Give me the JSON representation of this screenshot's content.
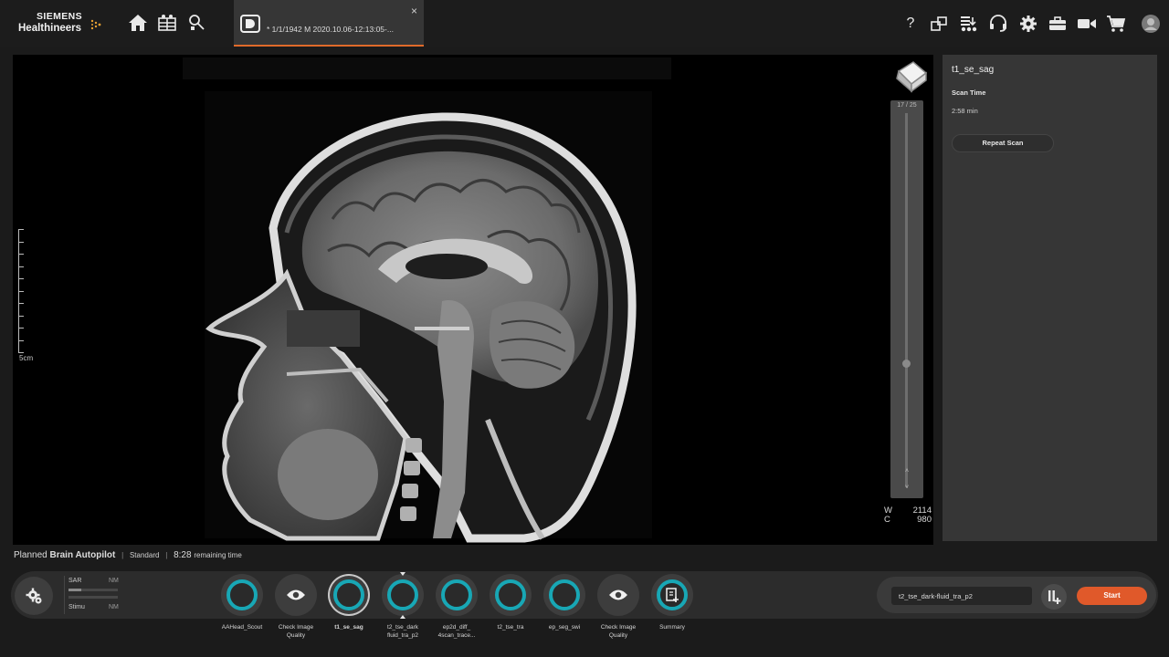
{
  "brand": {
    "line1": "SIEMENS",
    "line2": "Healthineers"
  },
  "nav": {
    "home_icon": "home-icon",
    "worklist_icon": "worklist-icon",
    "search_icon": "patient-search-icon"
  },
  "tab": {
    "label": "* 1/1/1942 M 2020.10.06-12:13:05-...",
    "close": "×",
    "icon": "patient-exam-icon"
  },
  "toolbar_right": [
    {
      "icon": "help-icon",
      "glyph": "?"
    },
    {
      "icon": "windows-icon"
    },
    {
      "icon": "queue-icon"
    },
    {
      "icon": "headset-icon"
    },
    {
      "icon": "settings-gear-icon"
    },
    {
      "icon": "toolbox-icon"
    },
    {
      "icon": "video-camera-icon"
    },
    {
      "icon": "cart-icon"
    },
    {
      "icon": "user-avatar-icon"
    }
  ],
  "viewer": {
    "ruler_label": "5cm",
    "slider_label": "17 / 25",
    "slider_position": 0.66,
    "slider_up": "˄",
    "slider_down": "˅",
    "window_label": "W",
    "window_value": "2114",
    "center_label": "C",
    "center_value": "980"
  },
  "side_panel": {
    "title": "t1_se_sag",
    "scan_time_label": "Scan Time",
    "scan_time_value": "2:58 min",
    "repeat_button": "Repeat Scan"
  },
  "status": {
    "planned": "Planned",
    "program": "Brain Autopilot",
    "mode": "Standard",
    "time": "8:28",
    "time_suffix": "remaining time"
  },
  "sar": {
    "sar_label": "SAR",
    "sar_value": "NM",
    "stim_label": "Stimu",
    "stim_value": "NM",
    "sar_fill": 0.25,
    "stim_fill": 0.0
  },
  "steps": [
    {
      "label1": "AAHead_Scout",
      "label2": "",
      "kind": "scan"
    },
    {
      "label1": "Check Image",
      "label2": "Quality",
      "kind": "eye"
    },
    {
      "label1": "t1_se_sag",
      "label2": "",
      "kind": "scan",
      "selected": true
    },
    {
      "label1": "t2_tse_dark",
      "label2": "fluid_tra_p2",
      "kind": "scan",
      "current": true
    },
    {
      "label1": "ep2d_diff_",
      "label2": "4scan_trace...",
      "kind": "scan"
    },
    {
      "label1": "t2_tse_tra",
      "label2": "",
      "kind": "scan"
    },
    {
      "label1": "ep_seg_swi",
      "label2": "",
      "kind": "scan"
    },
    {
      "label1": "Check Image",
      "label2": "Quality",
      "kind": "eye"
    },
    {
      "label1": "Summary",
      "label2": "",
      "kind": "summary"
    }
  ],
  "controls": {
    "protocol_value": "t2_tse_dark-fluid_tra_p2",
    "start_label": "Start",
    "add_icon": "pause-add-icon"
  },
  "colors": {
    "accent": "#18a7b5",
    "start": "#e0592a",
    "tab_underline": "#e06a2a"
  }
}
